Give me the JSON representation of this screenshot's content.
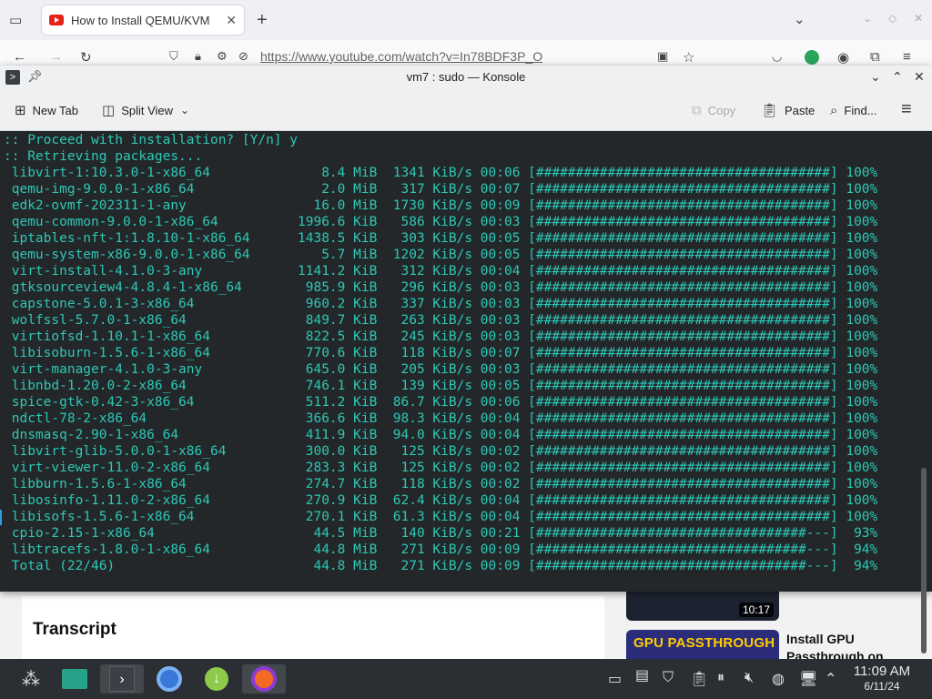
{
  "browser": {
    "tab_title": "How to Install QEMU/KVM",
    "url": "https://www.youtube.com/watch?v=In78BDF3P_O"
  },
  "page": {
    "transcript_heading": "Transcript",
    "video1_duration": "10:17",
    "video2_thumb_text": "GPU PASSTHROUGH",
    "video2_title": "Install GPU Passthrough on"
  },
  "konsole": {
    "title": "vm7 : sudo — Konsole",
    "toolbar": {
      "new_tab": "New Tab",
      "split_view": "Split View",
      "copy": "Copy",
      "paste": "Paste",
      "find": "Find..."
    },
    "lines": [
      ":: Proceed with installation? [Y/n] y",
      ":: Retrieving packages...",
      " libvirt-1:10.3.0-1-x86_64              8.4 MiB  1341 KiB/s 00:06 [#####################################] 100%",
      " qemu-img-9.0.0-1-x86_64                2.0 MiB   317 KiB/s 00:07 [#####################################] 100%",
      " edk2-ovmf-202311-1-any                16.0 MiB  1730 KiB/s 00:09 [#####################################] 100%",
      " qemu-common-9.0.0-1-x86_64          1996.6 KiB   586 KiB/s 00:03 [#####################################] 100%",
      " iptables-nft-1:1.8.10-1-x86_64      1438.5 KiB   303 KiB/s 00:05 [#####################################] 100%",
      " qemu-system-x86-9.0.0-1-x86_64         5.7 MiB  1202 KiB/s 00:05 [#####################################] 100%",
      " virt-install-4.1.0-3-any            1141.2 KiB   312 KiB/s 00:04 [#####################################] 100%",
      " gtksourceview4-4.8.4-1-x86_64        985.9 KiB   296 KiB/s 00:03 [#####################################] 100%",
      " capstone-5.0.1-3-x86_64              960.2 KiB   337 KiB/s 00:03 [#####################################] 100%",
      " wolfssl-5.7.0-1-x86_64               849.7 KiB   263 KiB/s 00:03 [#####################################] 100%",
      " virtiofsd-1.10.1-1-x86_64            822.5 KiB   245 KiB/s 00:03 [#####################################] 100%",
      " libisoburn-1.5.6-1-x86_64            770.6 KiB   118 KiB/s 00:07 [#####################################] 100%",
      " virt-manager-4.1.0-3-any             645.0 KiB   205 KiB/s 00:03 [#####################################] 100%",
      " libnbd-1.20.0-2-x86_64               746.1 KiB   139 KiB/s 00:05 [#####################################] 100%",
      " spice-gtk-0.42-3-x86_64              511.2 KiB  86.7 KiB/s 00:06 [#####################################] 100%",
      " ndctl-78-2-x86_64                    366.6 KiB  98.3 KiB/s 00:04 [#####################################] 100%",
      " dnsmasq-2.90-1-x86_64                411.9 KiB  94.0 KiB/s 00:04 [#####################################] 100%",
      " libvirt-glib-5.0.0-1-x86_64          300.0 KiB   125 KiB/s 00:02 [#####################################] 100%",
      " virt-viewer-11.0-2-x86_64            283.3 KiB   125 KiB/s 00:02 [#####################################] 100%",
      " libburn-1.5.6-1-x86_64               274.7 KiB   118 KiB/s 00:02 [#####################################] 100%",
      " libosinfo-1.11.0-2-x86_64            270.9 KiB  62.4 KiB/s 00:04 [#####################################] 100%",
      " libisofs-1.5.6-1-x86_64              270.1 KiB  61.3 KiB/s 00:04 [#####################################] 100%",
      " cpio-2.15-1-x86_64                    44.5 MiB   140 KiB/s 00:21 [##################################---]  93%",
      " libtracefs-1.8.0-1-x86_64             44.8 MiB   271 KiB/s 00:09 [##################################---]  94%",
      " Total (22/46)                         44.8 MiB   271 KiB/s 00:09 [##################################---]  94%"
    ]
  },
  "taskbar": {
    "time": "11:09 AM",
    "date": "6/11/24"
  },
  "colors": {
    "terminal_bg": "#232729",
    "terminal_fg": "#2ec7b6",
    "taskbar_bg": "#2b2f33"
  }
}
